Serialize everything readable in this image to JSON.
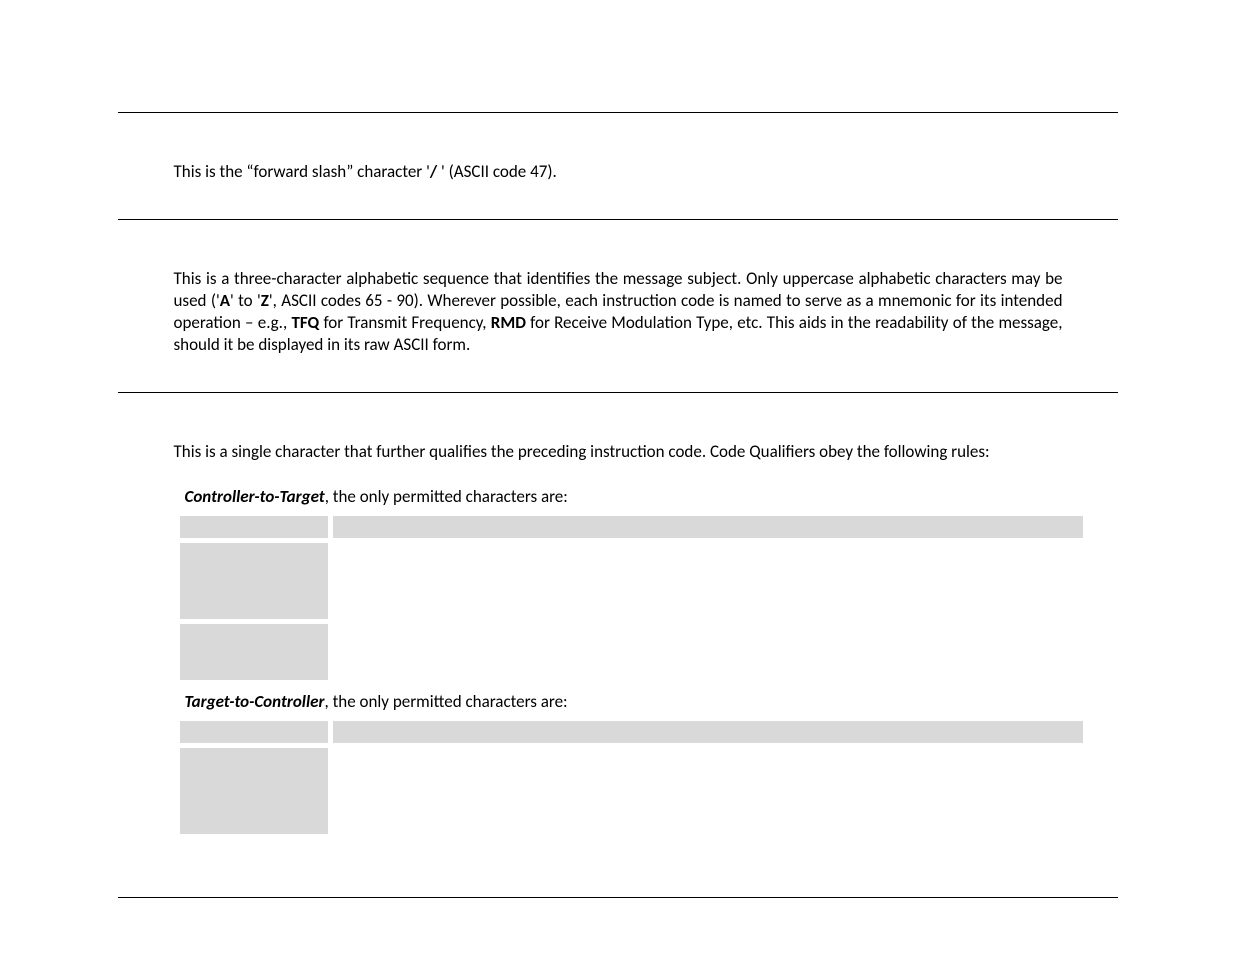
{
  "section1": {
    "pre": "This is the “forward slash” character '",
    "char": "/",
    "post": " ' (ASCII code 47)."
  },
  "section2": {
    "t1": "This is a three-character alphabetic sequence that identifies the message subject. Only uppercase alphabetic characters may be used ('",
    "A": "A",
    "t2": "' to '",
    "Z": "Z",
    "t3": "', ASCII codes 65 - 90). Wherever possible, each instruction code is named to serve as a mnemonic for its intended operation – e.g., ",
    "TFQ": "TFQ",
    "t4": " for Transmit Frequency, ",
    "RMD": "RMD",
    "t5": " for Receive Modulation Type, etc. This aids in the readability of the message, should it be displayed in its raw ASCII form."
  },
  "section3": {
    "lead": "This is a single character that further qualifies the preceding instruction code. Code Qualifiers obey the following rules:",
    "rule1_bold": "Controller-to-Target",
    "rule1_rest": ", the only permitted characters are:",
    "rule2_bold": "Target-to-Controller",
    "rule2_rest": ", the only permitted characters are:"
  }
}
